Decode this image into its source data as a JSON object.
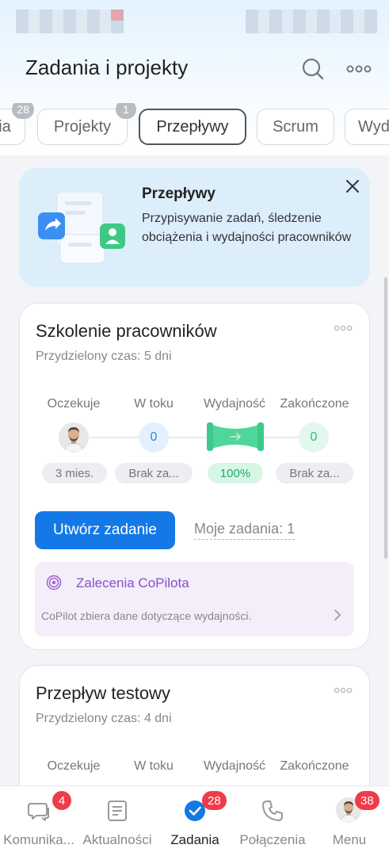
{
  "header": {
    "title": "Zadania i projekty"
  },
  "tabs": [
    {
      "label": "ia",
      "badge": "28"
    },
    {
      "label": "Projekty",
      "badge": "1"
    },
    {
      "label": "Przepływy",
      "active": true
    },
    {
      "label": "Scrum"
    },
    {
      "label": "Wyd"
    }
  ],
  "promo": {
    "title": "Przepływy",
    "description": "Przypisywanie zadań, śledzenie obciążenia i wydajności pracowników"
  },
  "columns": {
    "waiting": "Oczekuje",
    "in_progress": "W toku",
    "efficiency": "Wydajność",
    "done": "Zakończone"
  },
  "cards": [
    {
      "title": "Szkolenie pracowników",
      "time": "Przydzielony czas: 5 dni",
      "in_progress_count": "0",
      "done_count": "0",
      "pill_waiting": "3 mies.",
      "pill_progress": "Brak za...",
      "pill_efficiency": "100%",
      "pill_done": "Brak za...",
      "create_button": "Utwórz zadanie",
      "my_tasks": "Moje zadania: 1",
      "copilot_title": "Zalecenia CoPilota",
      "copilot_text": "CoPilot zbiera dane dotyczące wydajności."
    },
    {
      "title": "Przepływ testowy",
      "time": "Przydzielony czas: 4 dni"
    }
  ],
  "bottom_nav": [
    {
      "label": "Komunika...",
      "badge": "4",
      "icon": "chat-icon"
    },
    {
      "label": "Aktualności",
      "icon": "news-icon"
    },
    {
      "label": "Zadania",
      "badge": "28",
      "icon": "tasks-check-icon",
      "active": true
    },
    {
      "label": "Połączenia",
      "icon": "phone-icon"
    },
    {
      "label": "Menu",
      "badge": "38",
      "icon": "avatar"
    }
  ],
  "colors": {
    "accent": "#1479e6",
    "badge_red": "#ee3c4b",
    "copilot_purple": "#8a4fc7",
    "success_green": "#2dbd7c"
  }
}
